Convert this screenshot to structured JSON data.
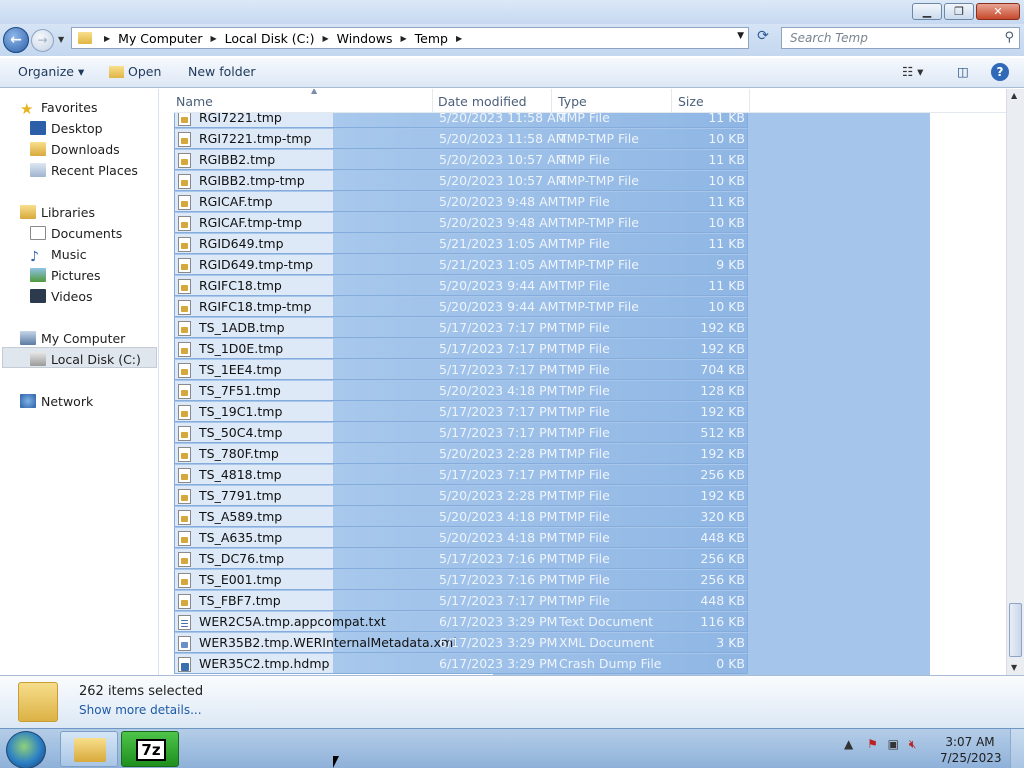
{
  "window": {
    "caption_minimize": "▁",
    "caption_maximize": "❐",
    "caption_close": "✕"
  },
  "nav": {
    "back": "←",
    "forward": "→",
    "breadcrumb": [
      "My Computer",
      "Local Disk (C:)",
      "Windows",
      "Temp"
    ],
    "search_placeholder": "Search Temp"
  },
  "toolbar": {
    "organize": "Organize ▾",
    "open": "Open",
    "new_folder": "New folder"
  },
  "sidebar": {
    "favorites": "Favorites",
    "desktop": "Desktop",
    "downloads": "Downloads",
    "recent_places": "Recent Places",
    "libraries": "Libraries",
    "documents": "Documents",
    "music": "Music",
    "pictures": "Pictures",
    "videos": "Videos",
    "my_computer": "My Computer",
    "local_disk": "Local Disk (C:)",
    "network": "Network"
  },
  "columns": {
    "name": "Name",
    "date": "Date modified",
    "type": "Type",
    "size": "Size"
  },
  "files": [
    {
      "name": "RGI7221.tmp",
      "date": "5/20/2023 11:58 AM",
      "type": "TMP File",
      "size": "11 KB",
      "icon": "tmp-file-icon"
    },
    {
      "name": "RGI7221.tmp-tmp",
      "date": "5/20/2023 11:58 AM",
      "type": "TMP-TMP File",
      "size": "10 KB",
      "icon": "tmp-file-icon"
    },
    {
      "name": "RGIBB2.tmp",
      "date": "5/20/2023 10:57 AM",
      "type": "TMP File",
      "size": "11 KB",
      "icon": "tmp-file-icon"
    },
    {
      "name": "RGIBB2.tmp-tmp",
      "date": "5/20/2023 10:57 AM",
      "type": "TMP-TMP File",
      "size": "10 KB",
      "icon": "tmp-file-icon"
    },
    {
      "name": "RGICAF.tmp",
      "date": "5/20/2023 9:48 AM",
      "type": "TMP File",
      "size": "11 KB",
      "icon": "tmp-file-icon"
    },
    {
      "name": "RGICAF.tmp-tmp",
      "date": "5/20/2023 9:48 AM",
      "type": "TMP-TMP File",
      "size": "10 KB",
      "icon": "tmp-file-icon"
    },
    {
      "name": "RGID649.tmp",
      "date": "5/21/2023 1:05 AM",
      "type": "TMP File",
      "size": "11 KB",
      "icon": "tmp-file-icon"
    },
    {
      "name": "RGID649.tmp-tmp",
      "date": "5/21/2023 1:05 AM",
      "type": "TMP-TMP File",
      "size": "9 KB",
      "icon": "tmp-file-icon"
    },
    {
      "name": "RGIFC18.tmp",
      "date": "5/20/2023 9:44 AM",
      "type": "TMP File",
      "size": "11 KB",
      "icon": "tmp-file-icon"
    },
    {
      "name": "RGIFC18.tmp-tmp",
      "date": "5/20/2023 9:44 AM",
      "type": "TMP-TMP File",
      "size": "10 KB",
      "icon": "tmp-file-icon"
    },
    {
      "name": "TS_1ADB.tmp",
      "date": "5/17/2023 7:17 PM",
      "type": "TMP File",
      "size": "192 KB",
      "icon": "tmp-file-icon"
    },
    {
      "name": "TS_1D0E.tmp",
      "date": "5/17/2023 7:17 PM",
      "type": "TMP File",
      "size": "192 KB",
      "icon": "tmp-file-icon"
    },
    {
      "name": "TS_1EE4.tmp",
      "date": "5/17/2023 7:17 PM",
      "type": "TMP File",
      "size": "704 KB",
      "icon": "tmp-file-icon"
    },
    {
      "name": "TS_7F51.tmp",
      "date": "5/20/2023 4:18 PM",
      "type": "TMP File",
      "size": "128 KB",
      "icon": "tmp-file-icon"
    },
    {
      "name": "TS_19C1.tmp",
      "date": "5/17/2023 7:17 PM",
      "type": "TMP File",
      "size": "192 KB",
      "icon": "tmp-file-icon"
    },
    {
      "name": "TS_50C4.tmp",
      "date": "5/17/2023 7:17 PM",
      "type": "TMP File",
      "size": "512 KB",
      "icon": "tmp-file-icon"
    },
    {
      "name": "TS_780F.tmp",
      "date": "5/20/2023 2:28 PM",
      "type": "TMP File",
      "size": "192 KB",
      "icon": "tmp-file-icon"
    },
    {
      "name": "TS_4818.tmp",
      "date": "5/17/2023 7:17 PM",
      "type": "TMP File",
      "size": "256 KB",
      "icon": "tmp-file-icon"
    },
    {
      "name": "TS_7791.tmp",
      "date": "5/20/2023 2:28 PM",
      "type": "TMP File",
      "size": "192 KB",
      "icon": "tmp-file-icon"
    },
    {
      "name": "TS_A589.tmp",
      "date": "5/20/2023 4:18 PM",
      "type": "TMP File",
      "size": "320 KB",
      "icon": "tmp-file-icon"
    },
    {
      "name": "TS_A635.tmp",
      "date": "5/20/2023 4:18 PM",
      "type": "TMP File",
      "size": "448 KB",
      "icon": "tmp-file-icon"
    },
    {
      "name": "TS_DC76.tmp",
      "date": "5/17/2023 7:16 PM",
      "type": "TMP File",
      "size": "256 KB",
      "icon": "tmp-file-icon"
    },
    {
      "name": "TS_E001.tmp",
      "date": "5/17/2023 7:16 PM",
      "type": "TMP File",
      "size": "256 KB",
      "icon": "tmp-file-icon"
    },
    {
      "name": "TS_FBF7.tmp",
      "date": "5/17/2023 7:17 PM",
      "type": "TMP File",
      "size": "448 KB",
      "icon": "tmp-file-icon"
    },
    {
      "name": "WER2C5A.tmp.appcompat.txt",
      "date": "6/17/2023 3:29 PM",
      "type": "Text Document",
      "size": "116 KB",
      "icon": "text-document-icon"
    },
    {
      "name": "WER35B2.tmp.WERInternalMetadata.xml",
      "date": "6/17/2023 3:29 PM",
      "type": "XML Document",
      "size": "3 KB",
      "icon": "xml-document-icon"
    },
    {
      "name": "WER35C2.tmp.hdmp",
      "date": "6/17/2023 3:29 PM",
      "type": "Crash Dump File",
      "size": "0 KB",
      "icon": "crash-dump-icon"
    }
  ],
  "details": {
    "count": "262 items selected",
    "more": "Show more details..."
  },
  "taskbar": {
    "app_7zip": "7z",
    "time": "3:07 AM",
    "date": "7/25/2023"
  }
}
